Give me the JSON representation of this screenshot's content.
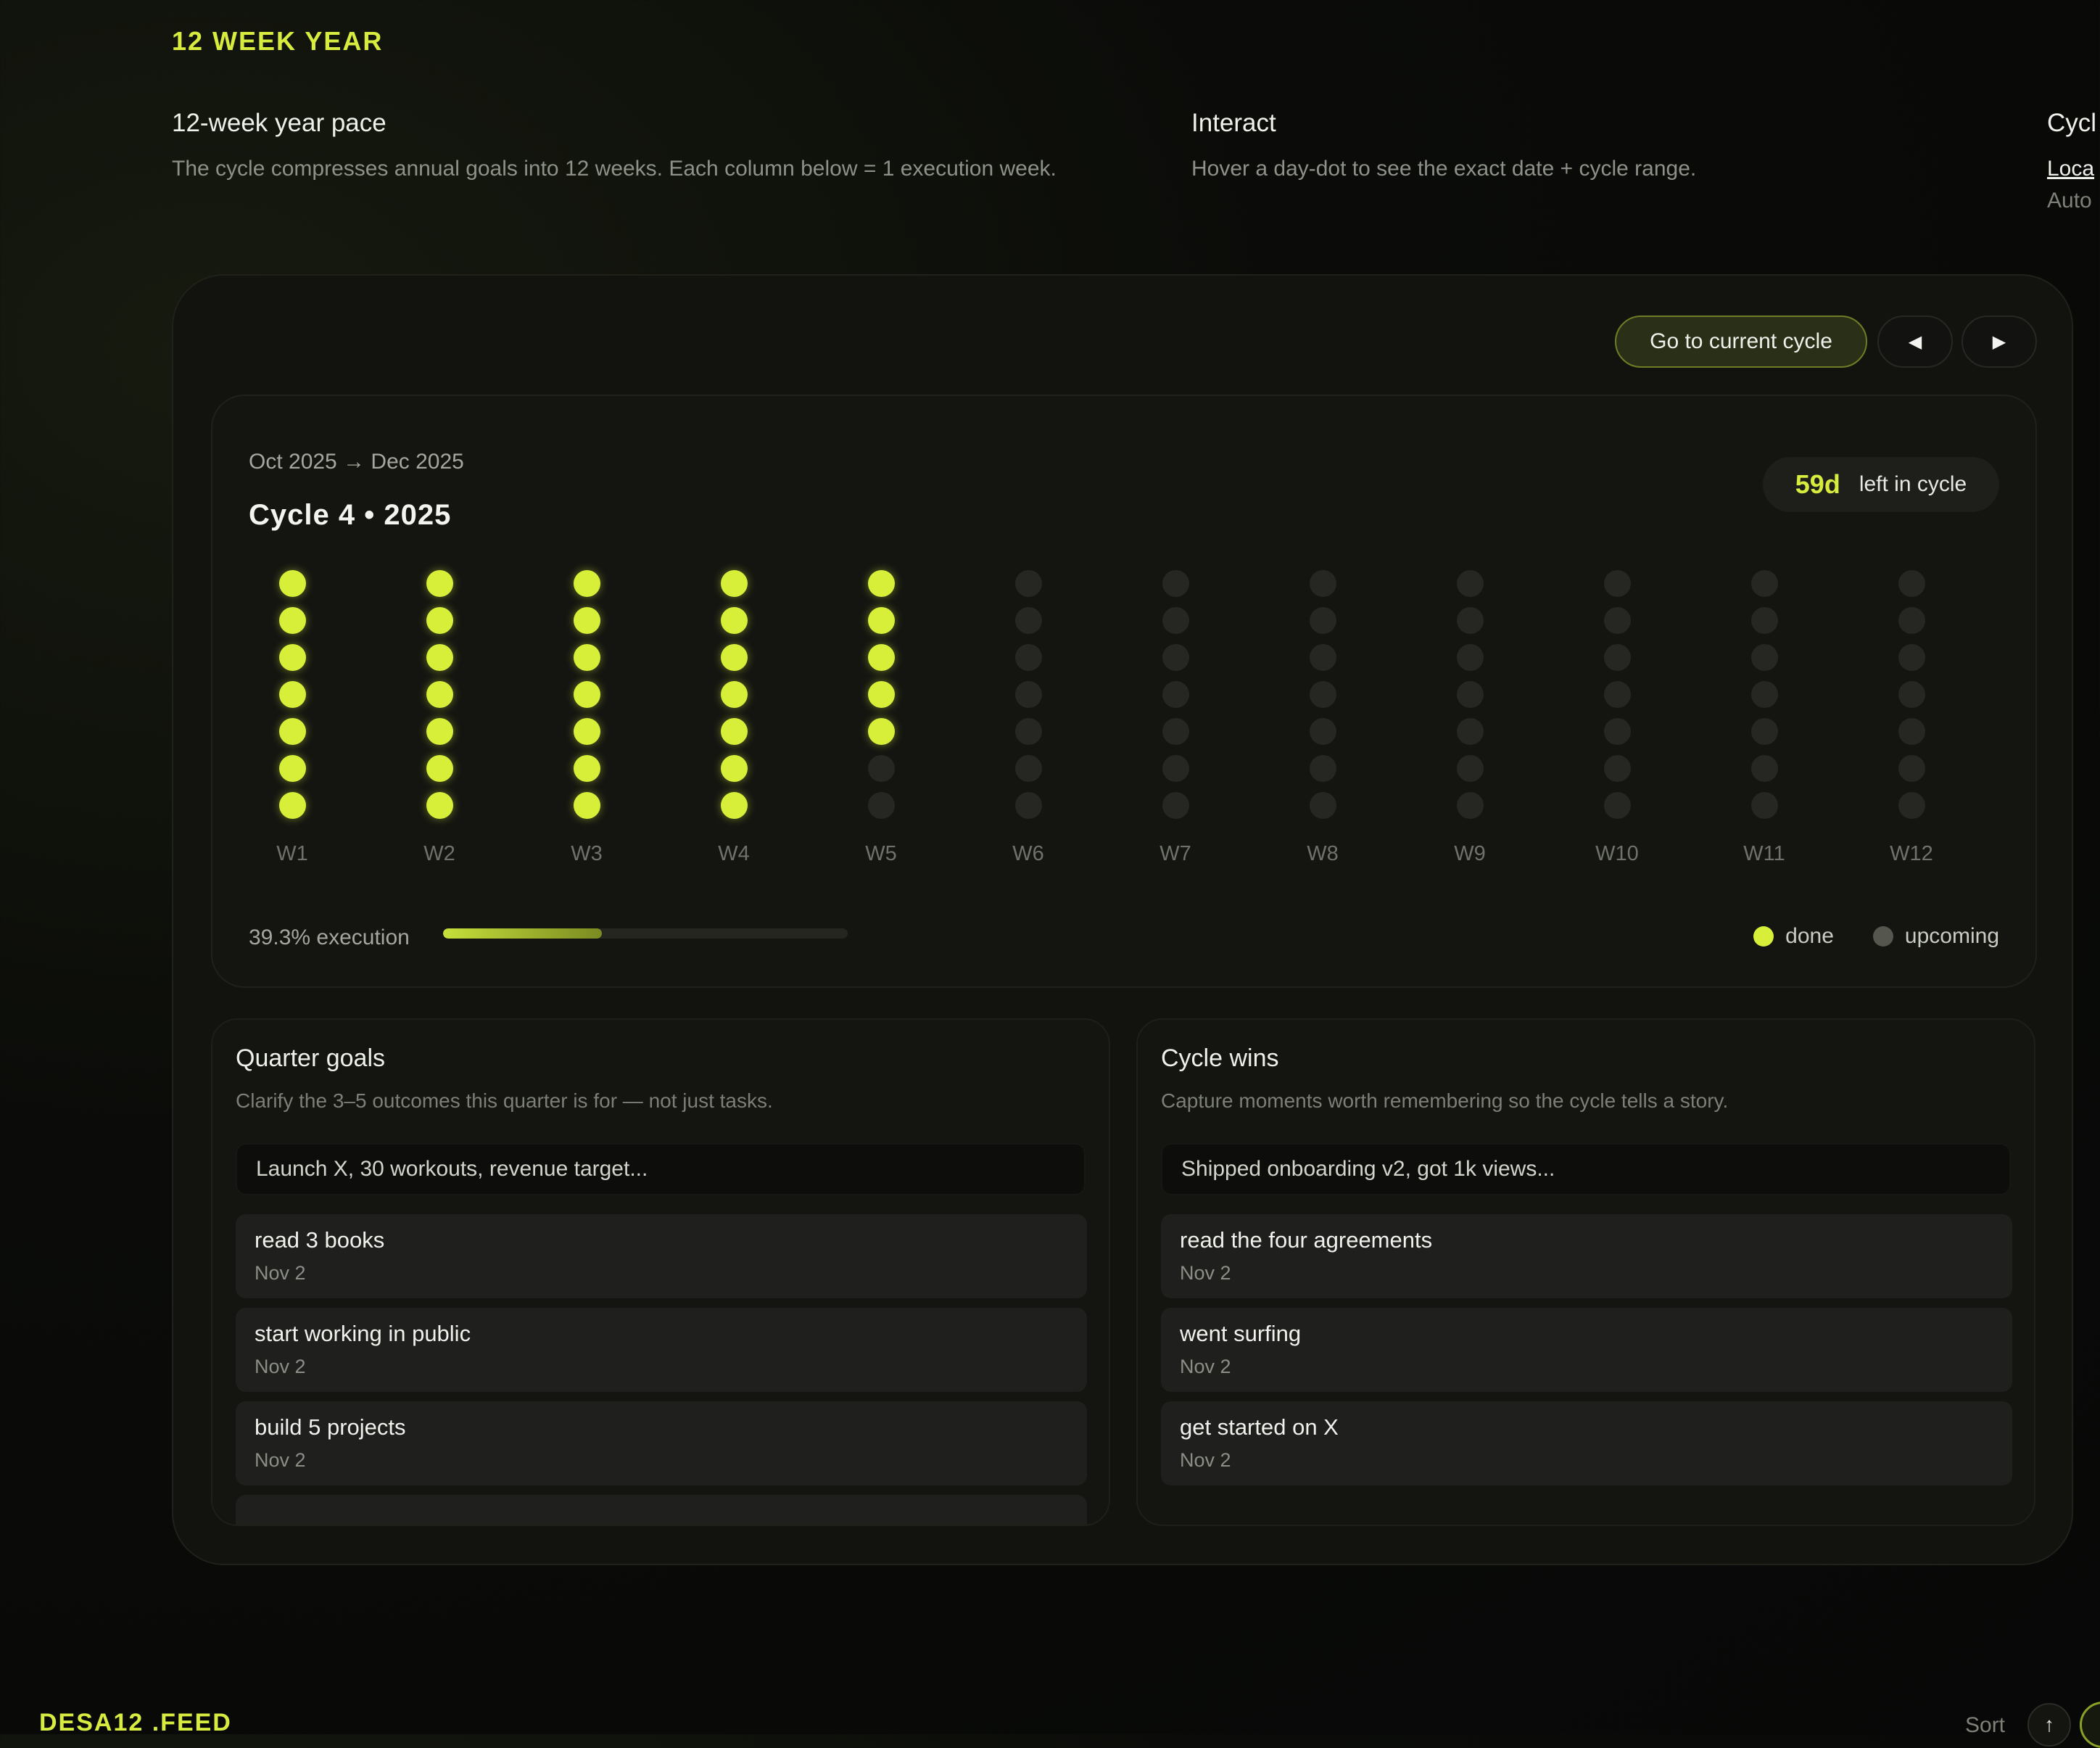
{
  "brand": "12 WEEK YEAR",
  "info": {
    "pace": {
      "title": "12-week year pace",
      "text": "The cycle compresses annual goals into 12 weeks. Each column below = 1 execution week."
    },
    "interact": {
      "title": "Interact",
      "text": "Hover a day-dot to see the exact date + cycle range."
    },
    "cycle": {
      "title": "Cycl",
      "link": "Loca",
      "sub": "Auto"
    }
  },
  "controls": {
    "current_label": "Go to current cycle",
    "prev_glyph": "◀",
    "next_glyph": "▶"
  },
  "cycle": {
    "range": "Oct 2025 → Dec 2025",
    "title": "Cycle 4 • 2025",
    "days_left": "59d",
    "days_left_suffix": "left in cycle",
    "execution_label": "39.3% execution",
    "execution_fraction": 0.393,
    "legend_done": "done",
    "legend_upcoming": "upcoming",
    "accent_color": "#d8ef3a",
    "weeks": [
      {
        "label": "W1",
        "done_days": 7
      },
      {
        "label": "W2",
        "done_days": 7
      },
      {
        "label": "W3",
        "done_days": 7
      },
      {
        "label": "W4",
        "done_days": 7
      },
      {
        "label": "W5",
        "done_days": 5
      },
      {
        "label": "W6",
        "done_days": 0
      },
      {
        "label": "W7",
        "done_days": 0
      },
      {
        "label": "W8",
        "done_days": 0
      },
      {
        "label": "W9",
        "done_days": 0
      },
      {
        "label": "W10",
        "done_days": 0
      },
      {
        "label": "W11",
        "done_days": 0
      },
      {
        "label": "W12",
        "done_days": 0
      }
    ]
  },
  "goals": {
    "title": "Quarter goals",
    "subtitle": "Clarify the 3–5 outcomes this quarter is for — not just tasks.",
    "placeholder": "Launch X, 30 workouts, revenue target...",
    "items": [
      {
        "title": "read 3 books",
        "date": "Nov 2"
      },
      {
        "title": "start working in public",
        "date": "Nov 2"
      },
      {
        "title": "build 5 projects",
        "date": "Nov 2"
      }
    ]
  },
  "wins": {
    "title": "Cycle wins",
    "subtitle": "Capture moments worth remembering so the cycle tells a story.",
    "placeholder": "Shipped onboarding v2, got 1k views...",
    "items": [
      {
        "title": "read the four agreements",
        "date": "Nov 2"
      },
      {
        "title": "went surfing",
        "date": "Nov 2"
      },
      {
        "title": "get started on X",
        "date": "Nov 2"
      }
    ]
  },
  "footer": {
    "feed_brand": "DESA12 .FEED",
    "sort_label": "Sort",
    "sort_glyph": "↑"
  }
}
